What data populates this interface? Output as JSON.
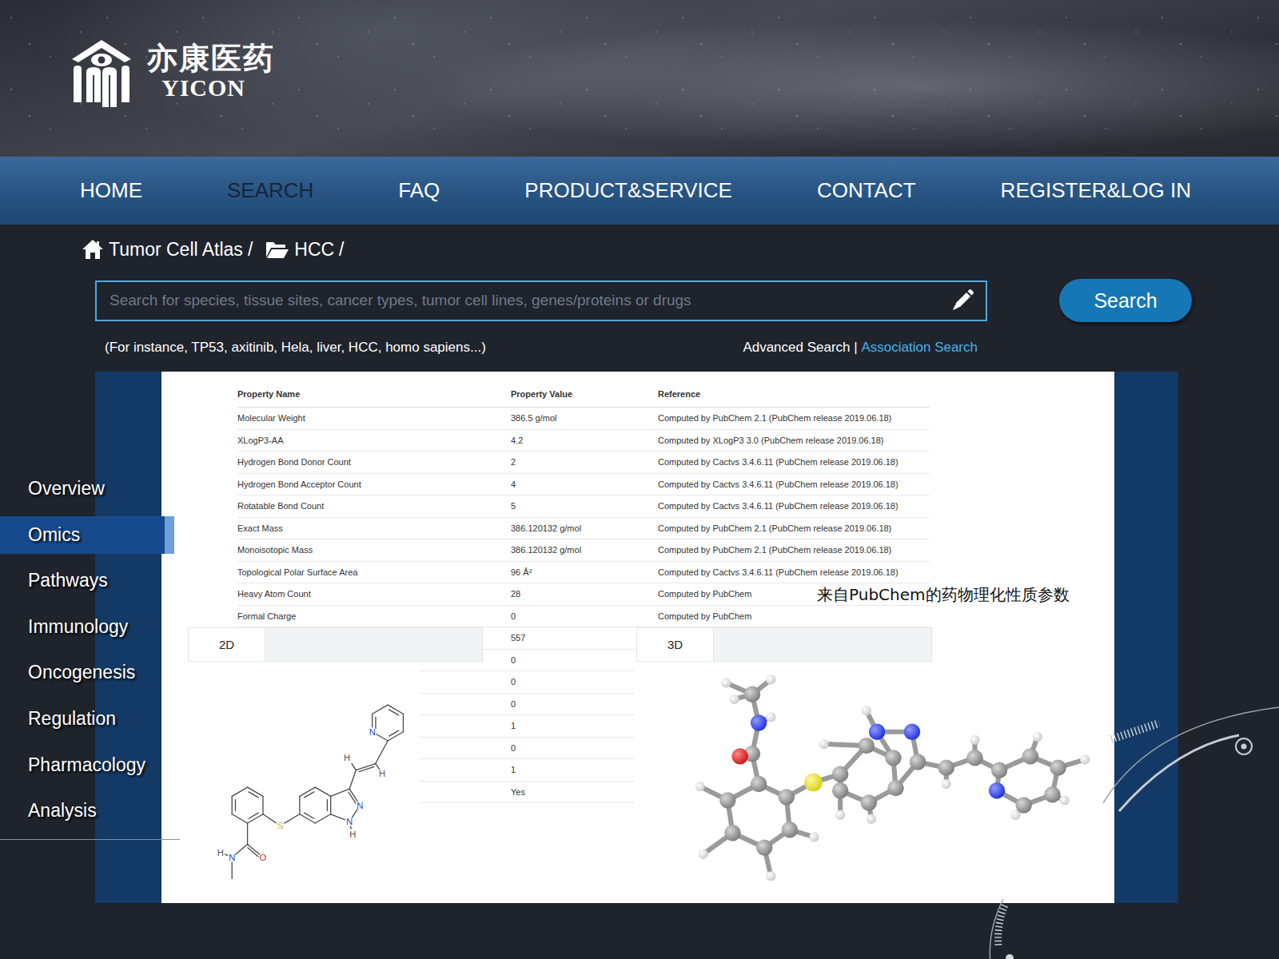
{
  "brand": {
    "name_cn": "亦康医药",
    "name_en": "YICON"
  },
  "nav": [
    {
      "label": "HOME",
      "selected": false
    },
    {
      "label": "SEARCH",
      "selected": true
    },
    {
      "label": "FAQ",
      "selected": false
    },
    {
      "label": "PRODUCT&SERVICE",
      "selected": false
    },
    {
      "label": "CONTACT",
      "selected": false
    },
    {
      "label": "REGISTER&LOG IN",
      "selected": false
    }
  ],
  "breadcrumb": {
    "items": [
      "Tumor Cell Atlas",
      "HCC"
    ],
    "separator": "/"
  },
  "search": {
    "placeholder": "Search for species, tissue sites, cancer types, tumor cell lines, genes/proteins or drugs",
    "button": "Search",
    "hint": "(For instance, TP53, axitinib, Hela, liver, HCC, homo sapiens...)",
    "links": [
      {
        "label": "Advanced Search",
        "highlighted": false
      },
      {
        "label": "Association Search",
        "highlighted": true
      }
    ],
    "link_separator": "|"
  },
  "sidebar": {
    "items": [
      {
        "label": "Overview",
        "selected": false
      },
      {
        "label": "Omics",
        "selected": true
      },
      {
        "label": "Pathways",
        "selected": false
      },
      {
        "label": "Immunology",
        "selected": false
      },
      {
        "label": "Oncogenesis",
        "selected": false
      },
      {
        "label": "Regulation",
        "selected": false
      },
      {
        "label": "Pharmacology",
        "selected": false
      },
      {
        "label": "Analysis",
        "selected": false
      }
    ]
  },
  "table": {
    "columns": [
      "Property Name",
      "Property Value",
      "Reference"
    ],
    "rows": [
      [
        "Molecular Weight",
        "386.5 g/mol",
        "Computed by PubChem 2.1 (PubChem release 2019.06.18)"
      ],
      [
        "XLogP3-AA",
        "4.2",
        "Computed by XLogP3 3.0 (PubChem release 2019.06.18)"
      ],
      [
        "Hydrogen Bond Donor Count",
        "2",
        "Computed by Cactvs 3.4.6.11 (PubChem release 2019.06.18)"
      ],
      [
        "Hydrogen Bond Acceptor Count",
        "4",
        "Computed by Cactvs 3.4.6.11 (PubChem release 2019.06.18)"
      ],
      [
        "Rotatable Bond Count",
        "5",
        "Computed by Cactvs 3.4.6.11 (PubChem release 2019.06.18)"
      ],
      [
        "Exact Mass",
        "386.120132 g/mol",
        "Computed by PubChem 2.1 (PubChem release 2019.06.18)"
      ],
      [
        "Monoisotopic Mass",
        "386.120132 g/mol",
        "Computed by PubChem 2.1 (PubChem release 2019.06.18)"
      ],
      [
        "Topological Polar Surface Area",
        "96 Å²",
        "Computed by Cactvs 3.4.6.11 (PubChem release 2019.06.18)"
      ],
      [
        "Heavy Atom Count",
        "28",
        "Computed by PubChem"
      ],
      [
        "Formal Charge",
        "0",
        "Computed by PubChem"
      ],
      [
        "",
        "557",
        ""
      ],
      [
        "",
        "0",
        ""
      ],
      [
        "",
        "0",
        ""
      ],
      [
        "",
        "0",
        ""
      ],
      [
        "",
        "1",
        ""
      ],
      [
        "",
        "0",
        ""
      ],
      [
        "",
        "1",
        ""
      ],
      [
        "",
        "Yes",
        ""
      ]
    ]
  },
  "annotation": "来自PubChem的药物理化性质参数",
  "structure_2d": {
    "tab": "2D",
    "atoms": [
      {
        "label": "N",
        "color": "#2a45c8"
      },
      {
        "label": "H",
        "color": "#555555"
      },
      {
        "label": "H",
        "color": "#555555"
      },
      {
        "label": "N",
        "color": "#2a45c8"
      },
      {
        "label": "N",
        "color": "#2a45c8"
      },
      {
        "label": "H",
        "color": "#555555"
      },
      {
        "label": "S",
        "color": "#b5b51e"
      },
      {
        "label": "O",
        "color": "#d42020"
      },
      {
        "label": "N",
        "color": "#2a45c8"
      },
      {
        "label": "H",
        "color": "#555555"
      }
    ]
  },
  "structure_3d": {
    "tab": "3D"
  }
}
